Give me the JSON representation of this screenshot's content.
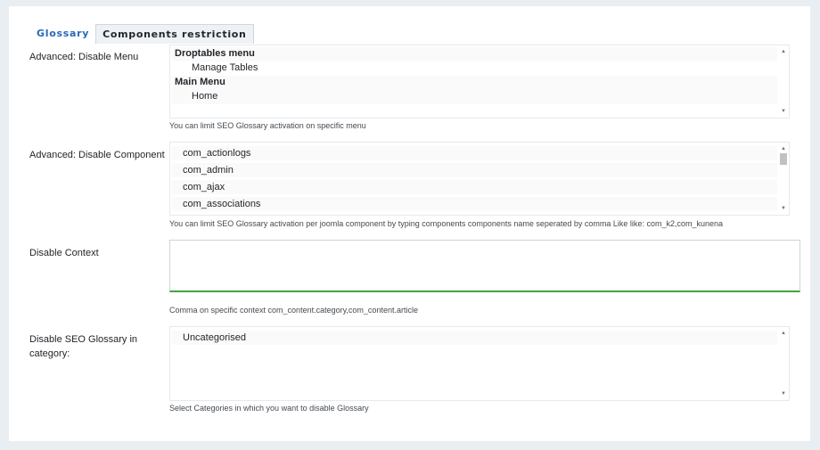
{
  "tabs": [
    "Glossary",
    "Components restriction"
  ],
  "fields": {
    "disable_menu": {
      "label": "Advanced: Disable Menu",
      "options": [
        {
          "text": "Droptables menu",
          "group": true
        },
        {
          "text": "Manage Tables",
          "group": false
        },
        {
          "text": "Main Menu",
          "group": true
        },
        {
          "text": "Home",
          "group": false
        }
      ],
      "help": "You can limit SEO Glossary activation on specific menu"
    },
    "disable_component": {
      "label": "Advanced: Disable Component",
      "options": [
        "com_actionlogs",
        "com_admin",
        "com_ajax",
        "com_associations"
      ],
      "help": "You can limit SEO Glossary activation per joomla component by typing components components name seperated by comma Like like: com_k2,com_kunena"
    },
    "disable_context": {
      "label": "Disable Context",
      "value": "",
      "help": "Comma on specific context com_content.category,com_content.article"
    },
    "disable_category": {
      "label_line1": "Disable SEO Glossary in",
      "label_line2": "category:",
      "options": [
        "Uncategorised"
      ],
      "help": "Select Categories in which you want to disable Glossary"
    }
  },
  "colors": {
    "tab_active_text": "#2a69b8",
    "textarea_focus_border": "#45a144",
    "page_background": "#e9eef3"
  }
}
